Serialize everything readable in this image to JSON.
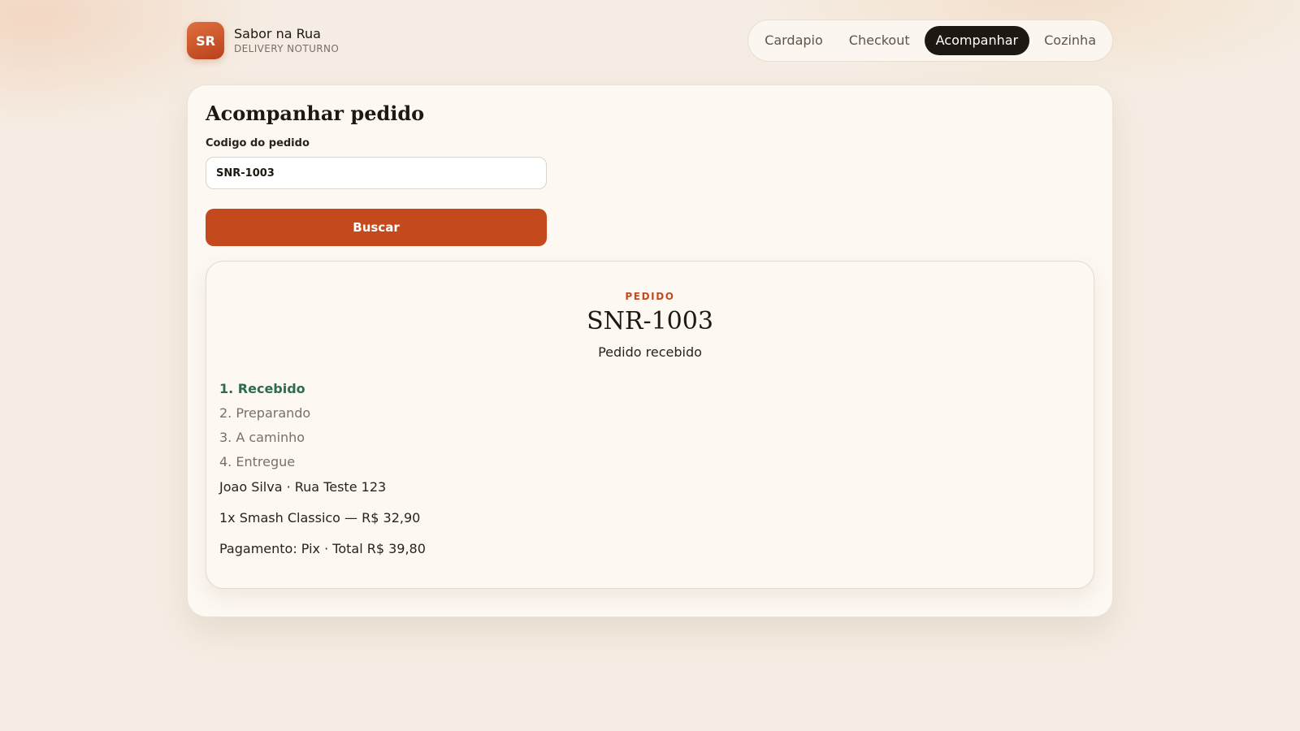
{
  "brand": {
    "initials": "SR",
    "name": "Sabor na Rua",
    "tagline": "DELIVERY NOTURNO"
  },
  "nav": {
    "items": [
      {
        "label": "Cardapio"
      },
      {
        "label": "Checkout"
      },
      {
        "label": "Acompanhar",
        "active": true
      },
      {
        "label": "Cozinha"
      }
    ]
  },
  "tracking": {
    "title": "Acompanhar pedido",
    "code_label": "Codigo do pedido",
    "code_value": "SNR-1003",
    "search_label": "Buscar"
  },
  "order": {
    "kicker": "PEDIDO",
    "code": "SNR-1003",
    "status": "Pedido recebido",
    "steps": [
      {
        "label": "1. Recebido",
        "current": true
      },
      {
        "label": "2. Preparando"
      },
      {
        "label": "3. A caminho"
      },
      {
        "label": "4. Entregue"
      }
    ],
    "customer": "Joao Silva · Rua Teste 123",
    "items": "1x Smash Classico — R$ 32,90",
    "payment": "Pagamento: Pix · Total R$ 39,80"
  },
  "colors": {
    "accent": "#c44a1e",
    "active_nav": "#1e1813",
    "step_current": "#2f6b4f"
  }
}
